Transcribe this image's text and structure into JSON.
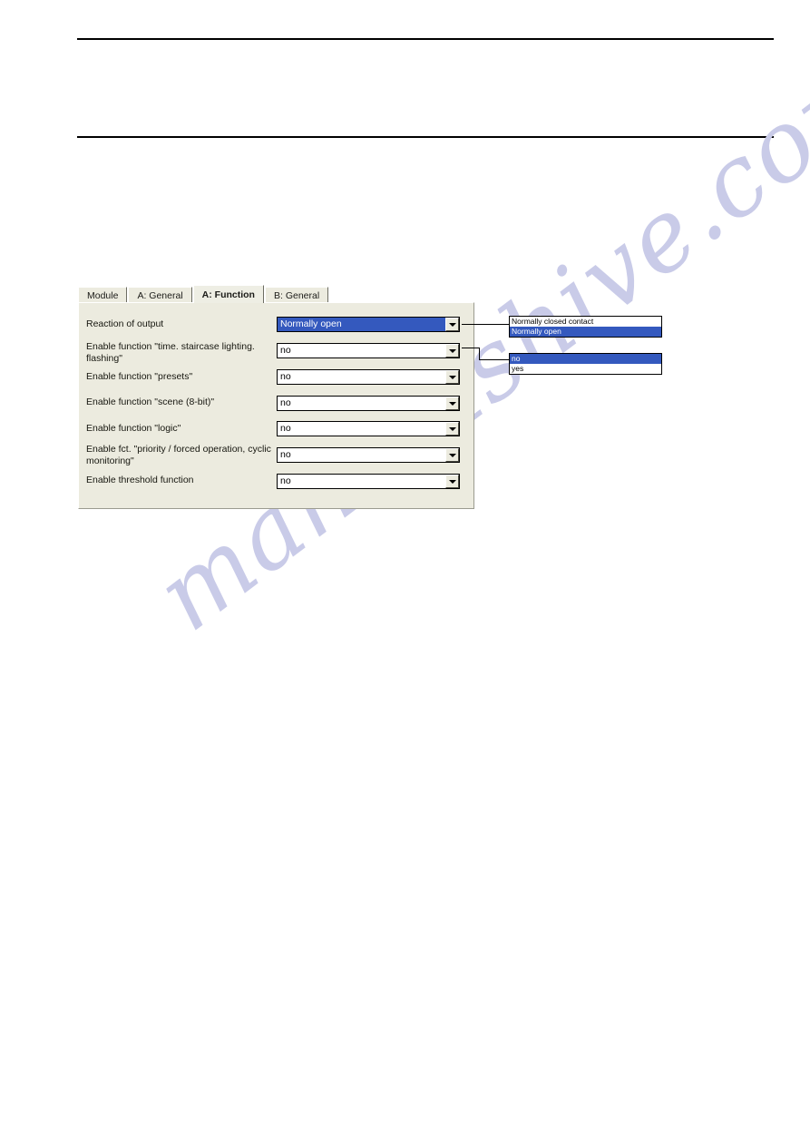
{
  "page": {
    "watermark_text": "manualshive.com",
    "rules": [
      "top-rule",
      "bottom-rule"
    ]
  },
  "dialog": {
    "tabs": [
      {
        "label": "Module",
        "active": false
      },
      {
        "label": "A: General",
        "active": false
      },
      {
        "label": "A: Function",
        "active": true
      },
      {
        "label": "B: General",
        "active": false
      }
    ],
    "fields": [
      {
        "label": "Reaction of output",
        "value": "Normally open",
        "selected": true
      },
      {
        "label": "Enable function \"time. staircase lighting. flashing\"",
        "value": "no",
        "selected": false
      },
      {
        "label": "Enable function \"presets\"",
        "value": "no",
        "selected": false
      },
      {
        "label": "Enable function \"scene (8-bit)\"",
        "value": "no",
        "selected": false
      },
      {
        "label": "Enable function \"logic\"",
        "value": "no",
        "selected": false
      },
      {
        "label": "Enable fct. \"priority / forced operation, cyclic monitoring\"",
        "value": "no",
        "selected": false
      },
      {
        "label": "Enable threshold function",
        "value": "no",
        "selected": false
      }
    ]
  },
  "popups": [
    {
      "name": "reaction-of-output-options",
      "options": [
        {
          "label": "Normally closed contact",
          "selected": false
        },
        {
          "label": "Normally open",
          "selected": true
        }
      ]
    },
    {
      "name": "enable-function-options",
      "options": [
        {
          "label": "no",
          "selected": true
        },
        {
          "label": "yes",
          "selected": false
        }
      ]
    }
  ],
  "colors": {
    "highlight_blue": "#3459be",
    "dialog_face": "#ecebdf",
    "watermark": "#c9cbe8"
  }
}
